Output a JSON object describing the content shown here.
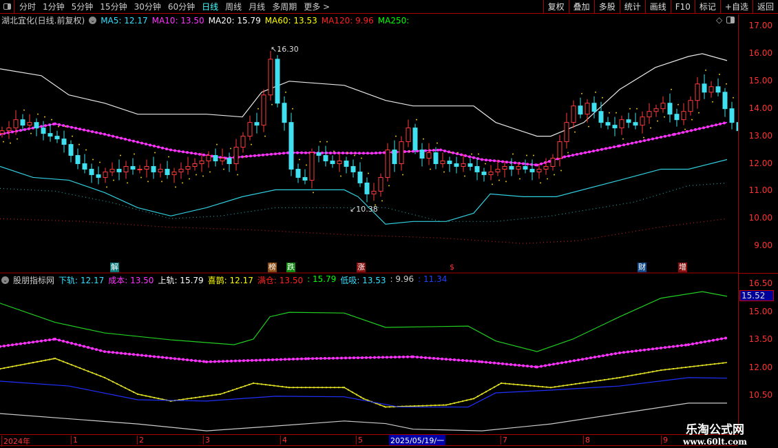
{
  "toolbar": {
    "periods": [
      "分时",
      "1分钟",
      "5分钟",
      "15分钟",
      "30分钟",
      "60分钟",
      "日线",
      "周线",
      "月线",
      "多周期",
      "更多 >"
    ],
    "active": "日线",
    "actions": [
      "复权",
      "叠加",
      "多股",
      "统计",
      "画线",
      "F10",
      "标记",
      "+自选",
      "返回"
    ]
  },
  "main_legend": {
    "title": "湖北宜化(日线.前复权)",
    "items": [
      {
        "text": "MA5: 12.17",
        "color": "#33e0ff"
      },
      {
        "text": "MA10: 13.50",
        "color": "#ff33ff"
      },
      {
        "text": "MA20: 15.79",
        "color": "#ffffff"
      },
      {
        "text": "MA60: 13.53",
        "color": "#ffff00"
      },
      {
        "text": "MA120: 9.96",
        "color": "#ff2020"
      },
      {
        "text": "MA250:",
        "color": "#00ff00"
      }
    ]
  },
  "sub_legend": {
    "title": "股朋指标网",
    "items": [
      {
        "text": "下轨: 12.17",
        "color": "#33e0ff"
      },
      {
        "text": "成本: 13.50",
        "color": "#ff33ff"
      },
      {
        "text": "上轨: 15.79",
        "color": "#ffffff"
      },
      {
        "text": "喜鹊: 12.17",
        "color": "#ffff00"
      },
      {
        "text": "满仓: 13.50",
        "color": "#ff2020"
      },
      {
        "text": ": 15.79",
        "color": "#00ff00"
      },
      {
        "text": "低吸: 13.53",
        "color": "#33e0ff"
      },
      {
        "text": ": 9.96",
        "color": "#cccccc"
      },
      {
        "text": ": 11.34",
        "color": "#2040ff"
      }
    ]
  },
  "main_axis": [
    "17.00",
    "16.00",
    "15.00",
    "14.00",
    "13.00",
    "12.00",
    "11.00",
    "10.00",
    "9.00"
  ],
  "sub_axis": [
    "16.50",
    "15.00",
    "13.50",
    "12.00",
    "10.50"
  ],
  "sub_current": "15.52",
  "annotations": {
    "high": "16.30",
    "low": "10.38"
  },
  "markers": [
    {
      "t": "解",
      "bg": "#0a7a7a"
    },
    {
      "t": "榜",
      "bg": "#8a4a10"
    },
    {
      "t": "跌",
      "bg": "#108a10"
    },
    {
      "t": "涨",
      "bg": "#8a1010"
    },
    {
      "t": "$",
      "bg": "transparent"
    },
    {
      "t": "财",
      "bg": "#104a8a"
    },
    {
      "t": "增",
      "bg": "#8a1010"
    }
  ],
  "dates": [
    "2024年",
    "1",
    "2",
    "3",
    "4",
    "5",
    "7",
    "8",
    "9"
  ],
  "selected_date": "2025/05/19/一",
  "watermark": {
    "name": "乐淘公式网",
    "url": "www.60lt.com"
  },
  "chart_data": {
    "type": "line",
    "note": "x = trading-day index, y = price",
    "main": {
      "ylim": [
        8.5,
        17.2
      ],
      "closes": [
        13.2,
        13.3,
        13.6,
        13.4,
        13.5,
        13.3,
        13.1,
        13.0,
        12.9,
        12.7,
        12.3,
        12.0,
        11.8,
        11.6,
        11.5,
        11.7,
        11.8,
        11.7,
        11.9,
        11.8,
        11.8,
        11.9,
        11.7,
        11.8,
        11.6,
        11.7,
        11.8,
        11.9,
        12.0,
        12.1,
        12.3,
        12.1,
        12.2,
        12.0,
        12.6,
        13.0,
        13.5,
        13.4,
        14.5,
        15.8,
        14.2,
        13.5,
        11.8,
        11.5,
        11.4,
        12.4,
        12.3,
        12.1,
        12.0,
        12.1,
        11.9,
        11.7,
        11.3,
        10.9,
        11.0,
        11.5,
        12.5,
        12.0,
        12.8,
        13.3,
        12.5,
        12.2,
        12.4,
        12.0,
        12.1,
        12.0,
        11.9,
        12.0,
        11.9,
        11.7,
        11.6,
        11.7,
        11.8,
        11.9,
        11.8,
        11.9,
        11.8,
        11.7,
        11.8,
        11.9,
        12.2,
        12.8,
        13.5,
        14.1,
        13.8,
        14.2,
        13.9,
        13.5,
        13.4,
        13.3,
        13.6,
        13.5,
        13.4,
        13.7,
        13.9,
        14.0,
        14.2,
        13.8,
        13.6,
        13.9,
        14.3,
        14.9,
        14.6,
        14.8,
        14.6,
        14.0,
        13.5,
        13.2
      ],
      "series": [
        {
          "name": "upper",
          "color": "#e8e8e8",
          "points": [
            [
              0,
              15.45
            ],
            [
              15,
              15.2
            ],
            [
              25,
              14.5
            ],
            [
              38,
              14.2
            ],
            [
              50,
              13.8
            ],
            [
              75,
              13.8
            ],
            [
              88,
              13.7
            ],
            [
              95,
              14.6
            ],
            [
              105,
              15.0
            ],
            [
              125,
              14.85
            ],
            [
              140,
              14.3
            ],
            [
              150,
              14.1
            ],
            [
              172,
              14.1
            ],
            [
              180,
              13.5
            ],
            [
              195,
              13.0
            ],
            [
              200,
              13.0
            ],
            [
              212,
              13.5
            ],
            [
              225,
              14.7
            ],
            [
              238,
              15.5
            ],
            [
              250,
              15.9
            ],
            [
              255,
              16.0
            ],
            [
              264,
              15.75
            ]
          ]
        },
        {
          "name": "lower",
          "color": "#30d0e0",
          "points": [
            [
              0,
              11.9
            ],
            [
              12,
              11.5
            ],
            [
              25,
              11.4
            ],
            [
              38,
              10.95
            ],
            [
              50,
              10.4
            ],
            [
              62,
              10.1
            ],
            [
              75,
              10.4
            ],
            [
              88,
              10.8
            ],
            [
              100,
              11.05
            ],
            [
              125,
              11.05
            ],
            [
              130,
              10.8
            ],
            [
              140,
              9.8
            ],
            [
              150,
              9.9
            ],
            [
              162,
              9.9
            ],
            [
              172,
              10.2
            ],
            [
              178,
              10.9
            ],
            [
              190,
              10.8
            ],
            [
              202,
              10.8
            ],
            [
              225,
              11.4
            ],
            [
              240,
              11.8
            ],
            [
              250,
              11.8
            ],
            [
              264,
              12.15
            ]
          ]
        },
        {
          "name": "ma",
          "color": "#ff33ff",
          "dots": true,
          "points": [
            [
              0,
              13.07
            ],
            [
              20,
              13.45
            ],
            [
              38,
              13.07
            ],
            [
              62,
              12.5
            ],
            [
              82,
              12.2
            ],
            [
              105,
              12.4
            ],
            [
              135,
              12.38
            ],
            [
              160,
              12.5
            ],
            [
              175,
              12.15
            ],
            [
              195,
              11.95
            ],
            [
              205,
              12.25
            ],
            [
              225,
              12.65
            ],
            [
              245,
              13.07
            ],
            [
              264,
              13.5
            ]
          ]
        },
        {
          "name": "dot-cyan",
          "color": "#20a0a0",
          "dotted": true,
          "points": [
            [
              0,
              11.1
            ],
            [
              20,
              11.0
            ],
            [
              40,
              10.6
            ],
            [
              62,
              10.0
            ],
            [
              80,
              10.1
            ],
            [
              100,
              10.4
            ],
            [
              140,
              10.4
            ],
            [
              160,
              9.9
            ],
            [
              180,
              9.9
            ],
            [
              200,
              10.1
            ],
            [
              230,
              10.6
            ],
            [
              250,
              11.2
            ],
            [
              264,
              11.3
            ]
          ]
        },
        {
          "name": "dot-red",
          "color": "#c02020",
          "dotted": true,
          "points": [
            [
              0,
              10.0
            ],
            [
              30,
              9.9
            ],
            [
              60,
              9.7
            ],
            [
              90,
              9.6
            ],
            [
              130,
              9.4
            ],
            [
              160,
              9.3
            ],
            [
              190,
              9.1
            ],
            [
              210,
              9.2
            ],
            [
              240,
              9.7
            ],
            [
              264,
              10.0
            ]
          ]
        }
      ]
    },
    "sub": {
      "ylim": [
        9.0,
        17.0
      ],
      "series": [
        {
          "name": "green",
          "color": "#20d020",
          "points": [
            [
              0,
              15.43
            ],
            [
              20,
              14.4
            ],
            [
              38,
              13.83
            ],
            [
              62,
              13.46
            ],
            [
              85,
              13.2
            ],
            [
              92,
              13.5
            ],
            [
              98,
              14.7
            ],
            [
              105,
              14.94
            ],
            [
              125,
              14.9
            ],
            [
              140,
              14.13
            ],
            [
              170,
              14.2
            ],
            [
              180,
              13.4
            ],
            [
              195,
              12.83
            ],
            [
              208,
              13.5
            ],
            [
              225,
              14.7
            ],
            [
              240,
              15.7
            ],
            [
              255,
              16.05
            ],
            [
              264,
              15.8
            ]
          ]
        },
        {
          "name": "magenta",
          "color": "#ff33ff",
          "dots": true,
          "points": [
            [
              0,
              13.1
            ],
            [
              20,
              13.5
            ],
            [
              38,
              12.83
            ],
            [
              75,
              12.28
            ],
            [
              112,
              12.45
            ],
            [
              150,
              12.55
            ],
            [
              175,
              12.28
            ],
            [
              195,
              12.0
            ],
            [
              225,
              12.76
            ],
            [
              250,
              13.2
            ],
            [
              264,
              13.57
            ]
          ]
        },
        {
          "name": "yellow",
          "color": "#e0e020",
          "dots": true,
          "points": [
            [
              0,
              11.9
            ],
            [
              20,
              12.46
            ],
            [
              38,
              11.43
            ],
            [
              50,
              10.54
            ],
            [
              62,
              10.17
            ],
            [
              80,
              10.54
            ],
            [
              92,
              11.13
            ],
            [
              105,
              10.9
            ],
            [
              125,
              10.9
            ],
            [
              132,
              10.3
            ],
            [
              140,
              9.85
            ],
            [
              162,
              9.96
            ],
            [
              172,
              10.3
            ],
            [
              182,
              11.13
            ],
            [
              200,
              10.9
            ],
            [
              225,
              11.43
            ],
            [
              240,
              11.83
            ],
            [
              264,
              12.24
            ]
          ]
        },
        {
          "name": "blue",
          "color": "#2030ff",
          "points": [
            [
              0,
              11.24
            ],
            [
              25,
              10.98
            ],
            [
              50,
              10.24
            ],
            [
              75,
              10.17
            ],
            [
              100,
              10.43
            ],
            [
              125,
              10.4
            ],
            [
              145,
              9.85
            ],
            [
              170,
              9.85
            ],
            [
              180,
              10.61
            ],
            [
              200,
              10.76
            ],
            [
              225,
              10.98
            ],
            [
              250,
              11.43
            ],
            [
              264,
              11.4
            ]
          ]
        },
        {
          "name": "white",
          "color": "#cccccc",
          "points": [
            [
              0,
              9.5
            ],
            [
              50,
              8.94
            ],
            [
              75,
              8.57
            ],
            [
              100,
              8.83
            ],
            [
              125,
              9.1
            ],
            [
              140,
              8.96
            ],
            [
              150,
              8.66
            ],
            [
              175,
              8.57
            ],
            [
              200,
              8.94
            ],
            [
              225,
              9.5
            ],
            [
              250,
              10.06
            ],
            [
              264,
              10.06
            ]
          ]
        }
      ]
    }
  }
}
